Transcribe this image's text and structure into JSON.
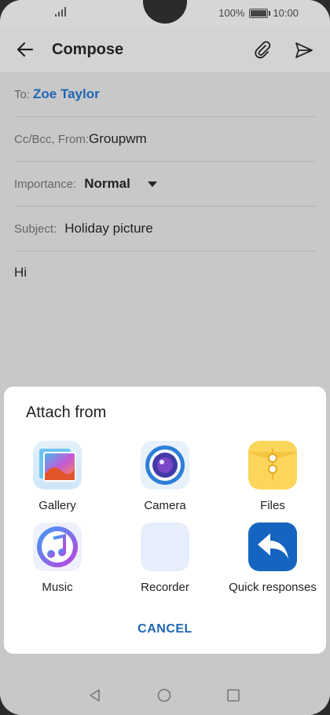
{
  "status": {
    "battery": "100%",
    "time": "10:00"
  },
  "appbar": {
    "title": "Compose"
  },
  "fields": {
    "to_label": "To:",
    "to_value": "Zoe Taylor",
    "ccbcc_label": "Cc/Bcc, From:",
    "ccbcc_value": "Groupwm",
    "importance_label": "Importance:",
    "importance_value": "Normal",
    "subject_label": "Subject:",
    "subject_value": "Holiday picture"
  },
  "body": {
    "text": "Hi"
  },
  "attach_sheet": {
    "title": "Attach from",
    "options": [
      {
        "label": "Gallery",
        "icon": "gallery-icon"
      },
      {
        "label": "Camera",
        "icon": "camera-icon"
      },
      {
        "label": "Files",
        "icon": "files-icon"
      },
      {
        "label": "Music",
        "icon": "music-icon"
      },
      {
        "label": "Recorder",
        "icon": "recorder-icon"
      },
      {
        "label": "Quick responses",
        "icon": "quick-responses-icon"
      }
    ],
    "cancel_label": "CANCEL"
  },
  "colors": {
    "accent": "#1f66b5"
  }
}
